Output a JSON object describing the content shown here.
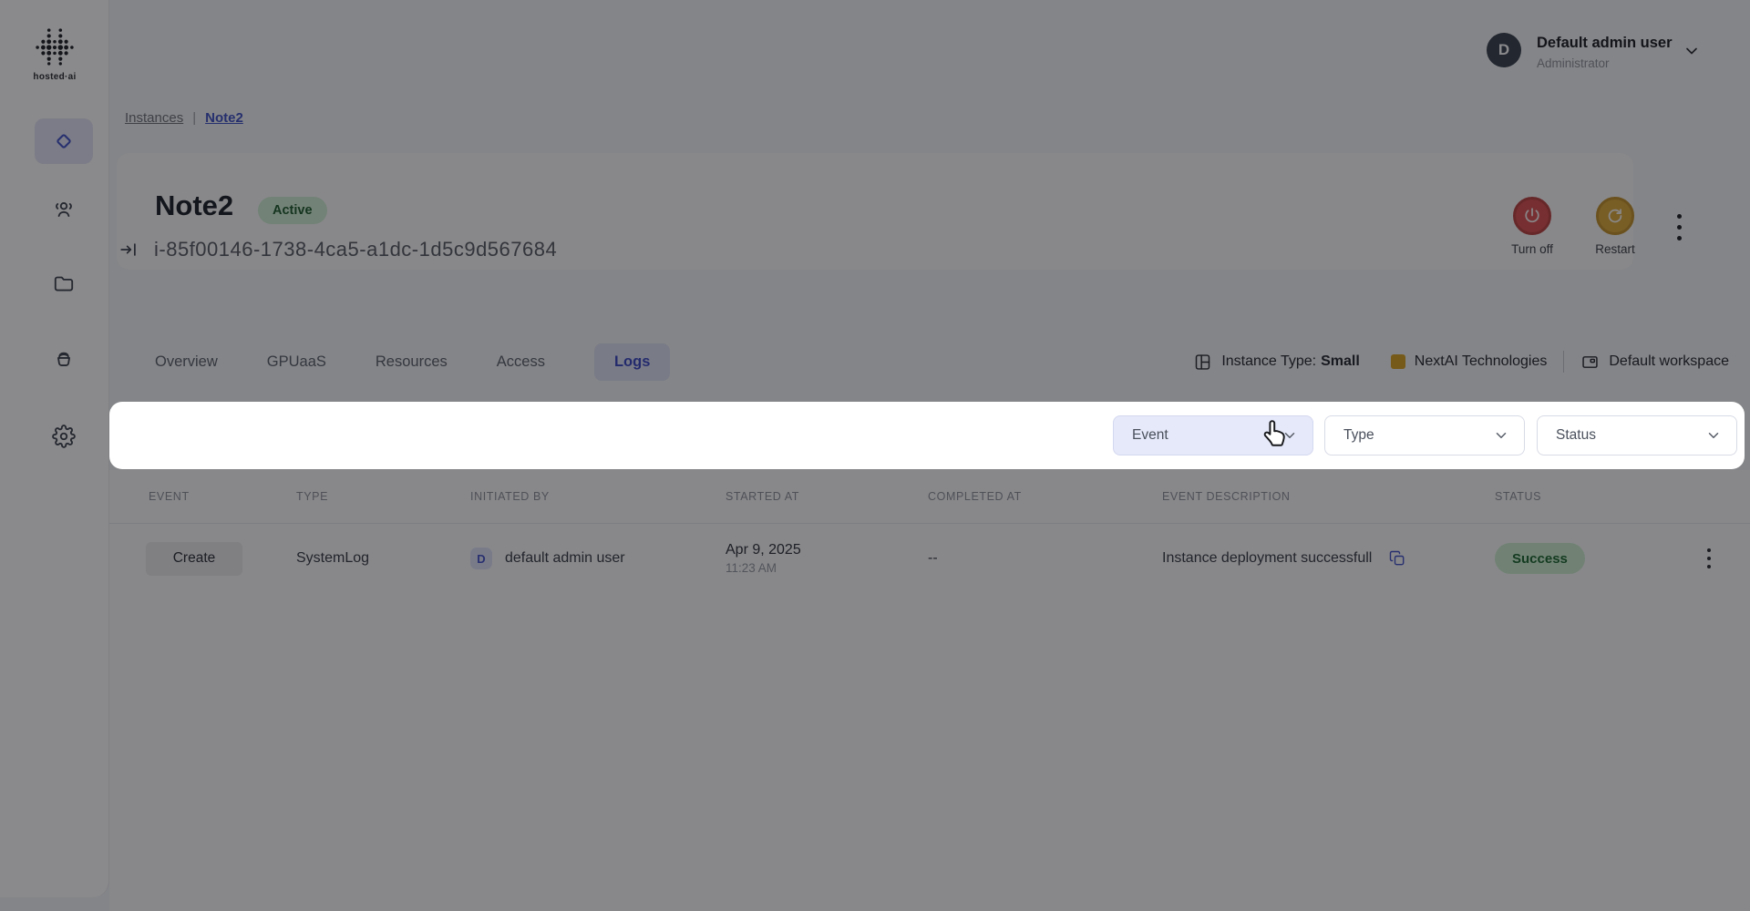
{
  "brand": {
    "logo_text": "hosted·ai",
    "logo_icon": "hostedai-dots-logo"
  },
  "user_menu": {
    "avatar_initial": "D",
    "name": "Default admin user",
    "role": "Administrator",
    "chevron_icon": "chevron-down-icon"
  },
  "sidebar": {
    "items": [
      {
        "icon": "diamond-icon",
        "name": "instances",
        "active": true
      },
      {
        "icon": "users-icon",
        "name": "users",
        "active": false
      },
      {
        "icon": "folder-icon",
        "name": "folders",
        "active": false
      },
      {
        "icon": "bucket-icon",
        "name": "storage",
        "active": false
      },
      {
        "icon": "gear-icon",
        "name": "settings",
        "active": false
      }
    ]
  },
  "breadcrumb": {
    "parent": "Instances",
    "separator": "|",
    "current": "Note2"
  },
  "instance": {
    "title": "Note2",
    "status": "Active",
    "id": "i-85f00146-1738-4ca5-a1dc-1d5c9d567684",
    "actions": {
      "turn_off": "Turn off",
      "restart": "Restart"
    }
  },
  "tabs": [
    {
      "label": "Overview",
      "active": false
    },
    {
      "label": "GPUaaS",
      "active": false
    },
    {
      "label": "Resources",
      "active": false
    },
    {
      "label": "Access",
      "active": false
    },
    {
      "label": "Logs",
      "active": true
    }
  ],
  "meta_bar": {
    "instance_type_label": "Instance Type:",
    "instance_type_value": "Small",
    "org_name": "NextAI Technologies",
    "org_swatch_color": "#D9A426",
    "workspace": "Default workspace"
  },
  "filter_bar": {
    "event_label": "Event",
    "type_label": "Type",
    "status_label": "Status",
    "cursor_icon": "hand-pointer-cursor",
    "highlight_color": "#E6E9F9"
  },
  "logs_table": {
    "columns": [
      "EVENT",
      "TYPE",
      "INITIATED BY",
      "STARTED AT",
      "COMPLETED AT",
      "EVENT DESCRIPTION",
      "STATUS"
    ],
    "rows": [
      {
        "event": "Create",
        "type": "SystemLog",
        "initiated_by_initial": "D",
        "initiated_by": "default admin user",
        "started_date": "Apr 9, 2025",
        "started_time": "11:23 AM",
        "completed_at": "--",
        "description": "Instance deployment successfull",
        "status": "Success"
      }
    ]
  },
  "colors": {
    "accent_indigo": "#4353C8",
    "active_badge_bg": "#D2EFD5",
    "active_badge_text": "#205C31",
    "success_badge_bg": "#CFF0D2",
    "success_badge_text": "#1D6933",
    "turn_off_red": "#DA5151",
    "restart_amber": "#DDAA3A",
    "dim_overlay": "rgba(10,11,14,0.48)"
  }
}
